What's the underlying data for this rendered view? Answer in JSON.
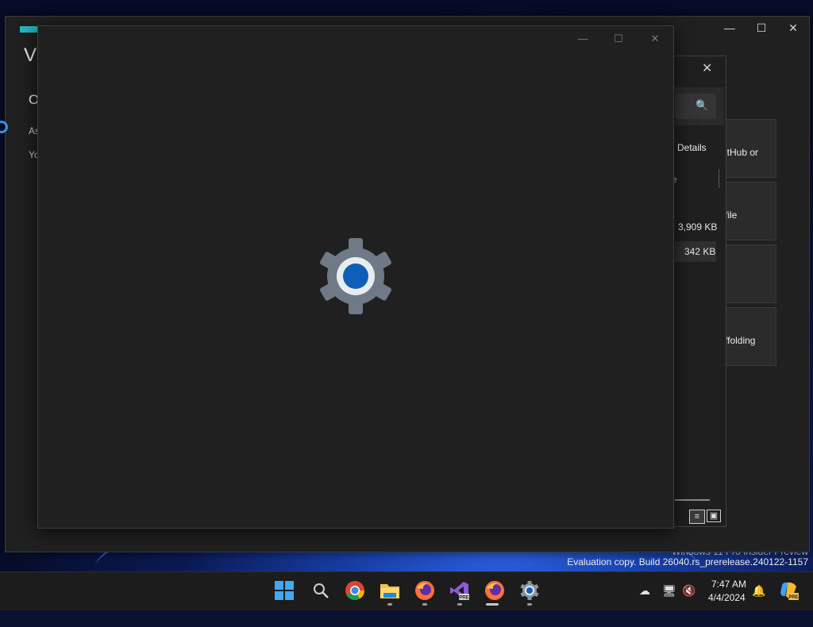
{
  "wallpaper": {
    "watermark_line1": "Windows 11 Pro Insider Preview",
    "watermark_line2": "Evaluation copy. Build 26040.rs_prerelease.240122-1157"
  },
  "vs_window": {
    "title": "Vi",
    "subtitle": "O",
    "line1": "As",
    "line2": "Yo",
    "controls": {
      "minimize": "—",
      "maximize": "☐",
      "close": "✕"
    },
    "cards": [
      {
        "label": "itHub or"
      },
      {
        "label": "file"
      },
      {
        "label": ""
      },
      {
        "label": "ffolding"
      }
    ]
  },
  "file_dialog": {
    "close": "✕",
    "search_icon": "🔍",
    "details_label": "Details",
    "column_fragment": "e",
    "rows": [
      {
        "size": "3,909 KB"
      },
      {
        "size": "342 KB"
      }
    ],
    "view_details": "≡",
    "view_tiles": "▣"
  },
  "settings_window": {
    "controls": {
      "minimize": "—",
      "maximize": "☐",
      "close": "✕"
    },
    "colors": {
      "gear_outer": "#6f7a86",
      "gear_ring": "#e9ecef",
      "gear_center": "#0f5fb8"
    }
  },
  "taskbar": {
    "apps": [
      {
        "name": "start",
        "icon": "windows-logo-icon"
      },
      {
        "name": "search",
        "icon": "search-icon"
      },
      {
        "name": "chrome",
        "icon": "chrome-icon"
      },
      {
        "name": "file-explorer",
        "icon": "folder-icon"
      },
      {
        "name": "firefox",
        "icon": "firefox-icon"
      },
      {
        "name": "visual-studio-preview",
        "icon": "visual-studio-icon"
      },
      {
        "name": "firefox-2",
        "icon": "firefox-icon"
      },
      {
        "name": "settings",
        "icon": "gear-icon"
      }
    ],
    "tray": {
      "network_off": "☁",
      "display": "🖥",
      "volume_muted": "🔇",
      "time": "7:47 AM",
      "date": "4/4/2024",
      "bell": "🔔",
      "copilot_badge": "PRE"
    }
  }
}
